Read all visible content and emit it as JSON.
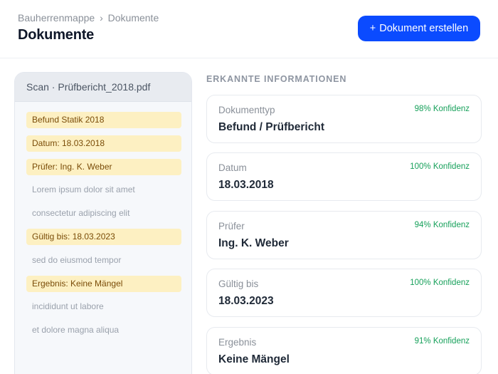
{
  "header": {
    "breadcrumb": {
      "parent": "Bauherrenmappe",
      "separator": "›",
      "current": "Dokumente"
    },
    "title": "Dokumente",
    "create_button": {
      "icon": "+",
      "label": "Dokument erstellen"
    }
  },
  "scan": {
    "title": "Scan · Prüfbericht_2018.pdf",
    "lines": [
      {
        "text": "Befund Statik 2018",
        "highlighted": true
      },
      {
        "text": "Datum: 18.03.2018",
        "highlighted": true
      },
      {
        "text": "Prüfer: Ing. K. Weber",
        "highlighted": true
      },
      {
        "text": "Lorem ipsum dolor sit amet",
        "highlighted": false
      },
      {
        "text": "consectetur adipiscing elit",
        "highlighted": false
      },
      {
        "text": "Gültig bis: 18.03.2023",
        "highlighted": true
      },
      {
        "text": "sed do eiusmod tempor",
        "highlighted": false
      },
      {
        "text": "Ergebnis: Keine Mängel",
        "highlighted": true
      },
      {
        "text": "incididunt ut labore",
        "highlighted": false
      },
      {
        "text": "et dolore magna aliqua",
        "highlighted": false
      }
    ]
  },
  "extracted": {
    "section_title": "ERKANNTE INFORMATIONEN",
    "fields": [
      {
        "label": "Dokumenttyp",
        "confidence": "98% Konfidenz",
        "value": "Befund / Prüfbericht"
      },
      {
        "label": "Datum",
        "confidence": "100% Konfidenz",
        "value": "18.03.2018"
      },
      {
        "label": "Prüfer",
        "confidence": "94% Konfidenz",
        "value": "Ing. K. Weber"
      },
      {
        "label": "Gültig bis",
        "confidence": "100% Konfidenz",
        "value": "18.03.2023"
      },
      {
        "label": "Ergebnis",
        "confidence": "91% Konfidenz",
        "value": "Keine Mängel"
      }
    ]
  },
  "colors": {
    "accent": "#0b4bff",
    "highlight_bg": "#fdf0c2",
    "highlight_text": "#7a4c08",
    "confidence": "#16a05a"
  }
}
